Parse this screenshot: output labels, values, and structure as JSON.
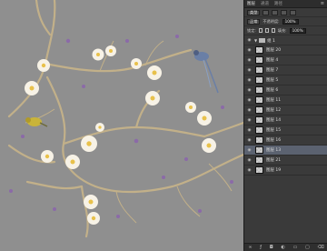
{
  "panel": {
    "tabs": [
      "图层",
      "通道",
      "路径"
    ],
    "filter": {
      "label": "类型"
    },
    "blend": {
      "mode": "正常",
      "opacity_label": "不透明度:",
      "opacity_value": "100%"
    },
    "lock": {
      "label": "锁定:",
      "fill_label": "填充:",
      "fill_value": "100%"
    },
    "group": {
      "name": "组 1"
    },
    "layers": [
      "图层 20",
      "图层 4",
      "图层 7",
      "图层 5",
      "图层 6",
      "图层 11",
      "图层 12",
      "图层 14",
      "图层 15",
      "图层 16",
      "图层 13",
      "图层 21",
      "图层 19"
    ],
    "selected_layer": "图层 13",
    "bottom_icons": [
      "link-icon",
      "fx-icon",
      "mask-icon",
      "adjustment-icon",
      "folder-icon",
      "new-layer-icon",
      "trash-icon"
    ]
  },
  "colors": {
    "canvas": "#8f8f8f",
    "panel": "#3a3a3a",
    "selected_row": "#5b6270",
    "branch": "#c2b089",
    "blossom": "#f7f2e6",
    "blossom_center": "#e8c14b",
    "bird_blue": "#6a7fa6",
    "bird_yellow": "#c9b43a"
  }
}
